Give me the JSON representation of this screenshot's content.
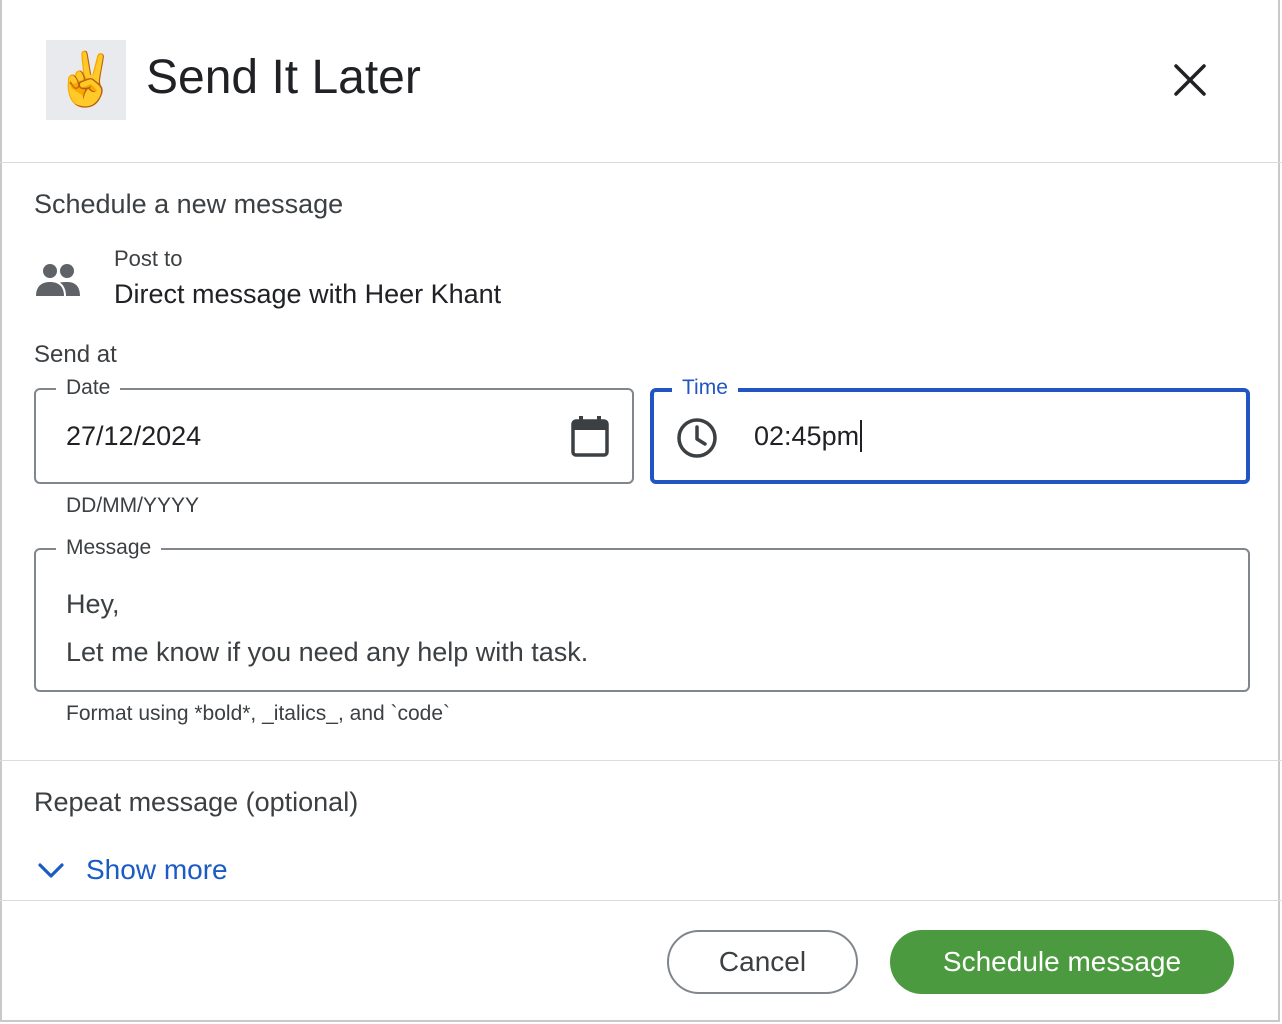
{
  "header": {
    "logo_emoji": "✌️",
    "title": "Send It Later",
    "close_icon": "close-icon"
  },
  "form": {
    "heading": "Schedule a new message",
    "post_to": {
      "label": "Post to",
      "value": "Direct message with Heer Khant",
      "icon": "people-icon"
    },
    "send_at": {
      "label": "Send at",
      "date": {
        "legend": "Date",
        "value": "27/12/2024",
        "hint": "DD/MM/YYYY",
        "icon": "calendar-icon"
      },
      "time": {
        "legend": "Time",
        "value": "02:45pm",
        "icon": "clock-icon",
        "focused": true
      }
    },
    "message": {
      "legend": "Message",
      "lines": [
        "Hey,",
        "Let me know if you need any help with task."
      ],
      "hint": "Format using *bold*, _italics_, and `code`"
    }
  },
  "repeat": {
    "heading": "Repeat message (optional)",
    "toggle_label": "Show more",
    "icon": "chevron-down-icon"
  },
  "footer": {
    "cancel_label": "Cancel",
    "schedule_label": "Schedule message"
  },
  "colors": {
    "accent_blue": "#2255c4",
    "link_blue": "#1a5bc4",
    "primary_green": "#4c9a3f",
    "border_gray": "#80868b"
  }
}
